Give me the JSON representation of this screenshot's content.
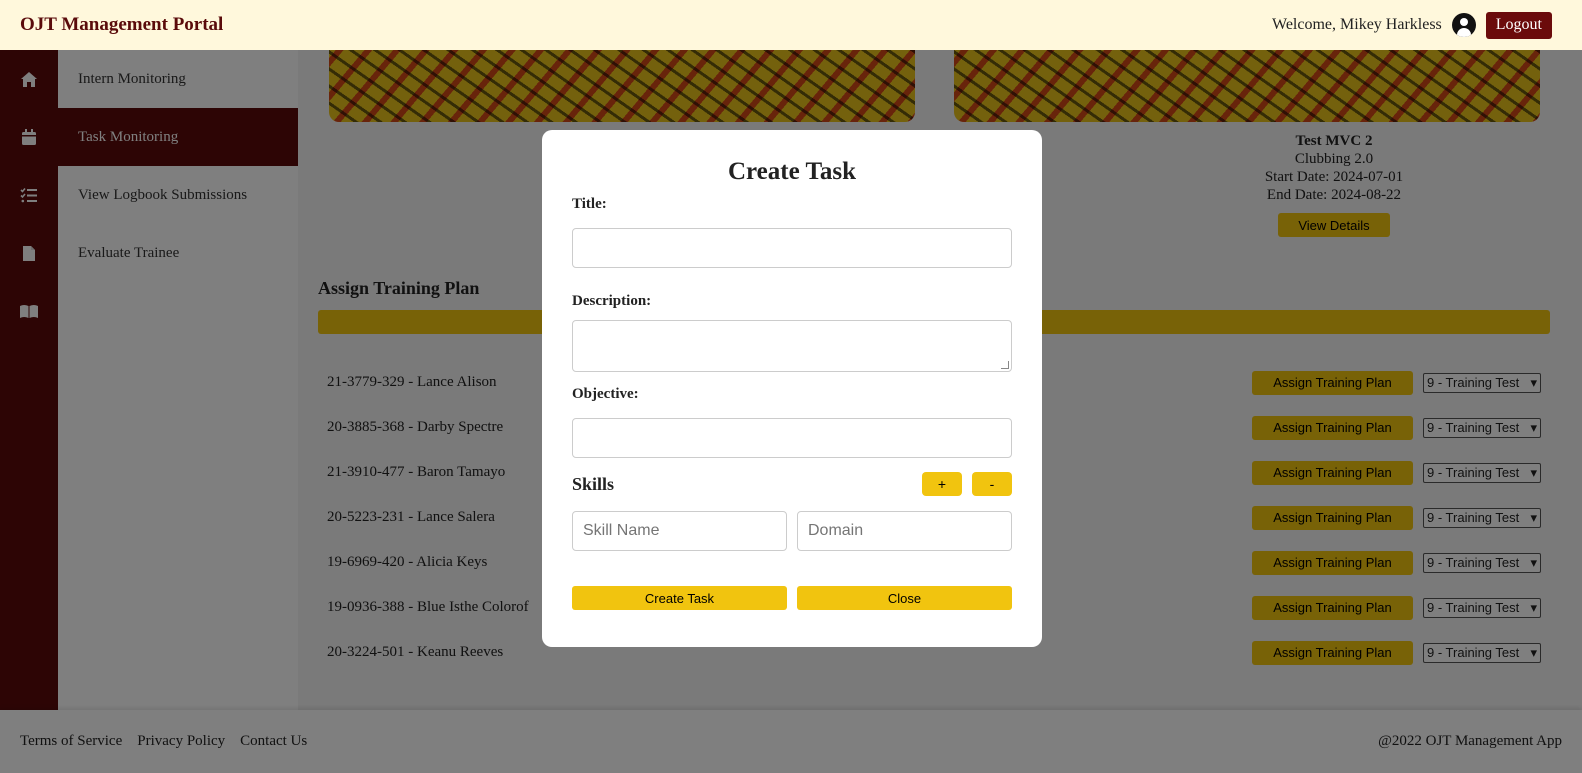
{
  "header": {
    "brand": "OJT Management Portal",
    "welcome": "Welcome, Mikey Harkless",
    "logout": "Logout"
  },
  "sidebar": {
    "icons": [
      "home-icon",
      "calendar-icon",
      "checklist-icon",
      "file-icon",
      "book-icon"
    ],
    "items": [
      {
        "label": "Intern Monitoring",
        "active": false
      },
      {
        "label": "Task Monitoring",
        "active": true
      },
      {
        "label": "View Logbook Submissions",
        "active": false
      },
      {
        "label": "Evaluate Trainee",
        "active": false
      }
    ]
  },
  "card": {
    "title": "Test MVC 2",
    "subtitle": "Clubbing 2.0",
    "start": "Start Date: 2024-07-01",
    "end": "End Date: 2024-08-22",
    "button": "View Details"
  },
  "assign": {
    "title": "Assign Training Plan",
    "button_label": "Assign Training Plan",
    "select_value": "9 - Training Test",
    "trainees": [
      "21-3779-329 - Lance Alison",
      "20-3885-368 - Darby Spectre",
      "21-3910-477 - Baron Tamayo",
      "20-5223-231 - Lance Salera",
      "19-6969-420 - Alicia Keys",
      "19-0936-388 - Blue Isthe Colorof",
      "20-3224-501 - Keanu Reeves"
    ]
  },
  "modal": {
    "title": "Create Task",
    "title_label": "Title:",
    "description_label": "Description:",
    "objective_label": "Objective:",
    "skills_label": "Skills",
    "add_label": "+",
    "remove_label": "-",
    "skill_name_placeholder": "Skill Name",
    "domain_placeholder": "Domain",
    "create_button": "Create Task",
    "close_button": "Close"
  },
  "footer": {
    "links": [
      "Terms of Service",
      "Privacy Policy",
      "Contact Us"
    ],
    "copyright": "@2022 OJT Management App"
  },
  "colors": {
    "primary": "#5a0b0b",
    "accent": "#f1c40f",
    "header_bg": "#fff8dc"
  }
}
